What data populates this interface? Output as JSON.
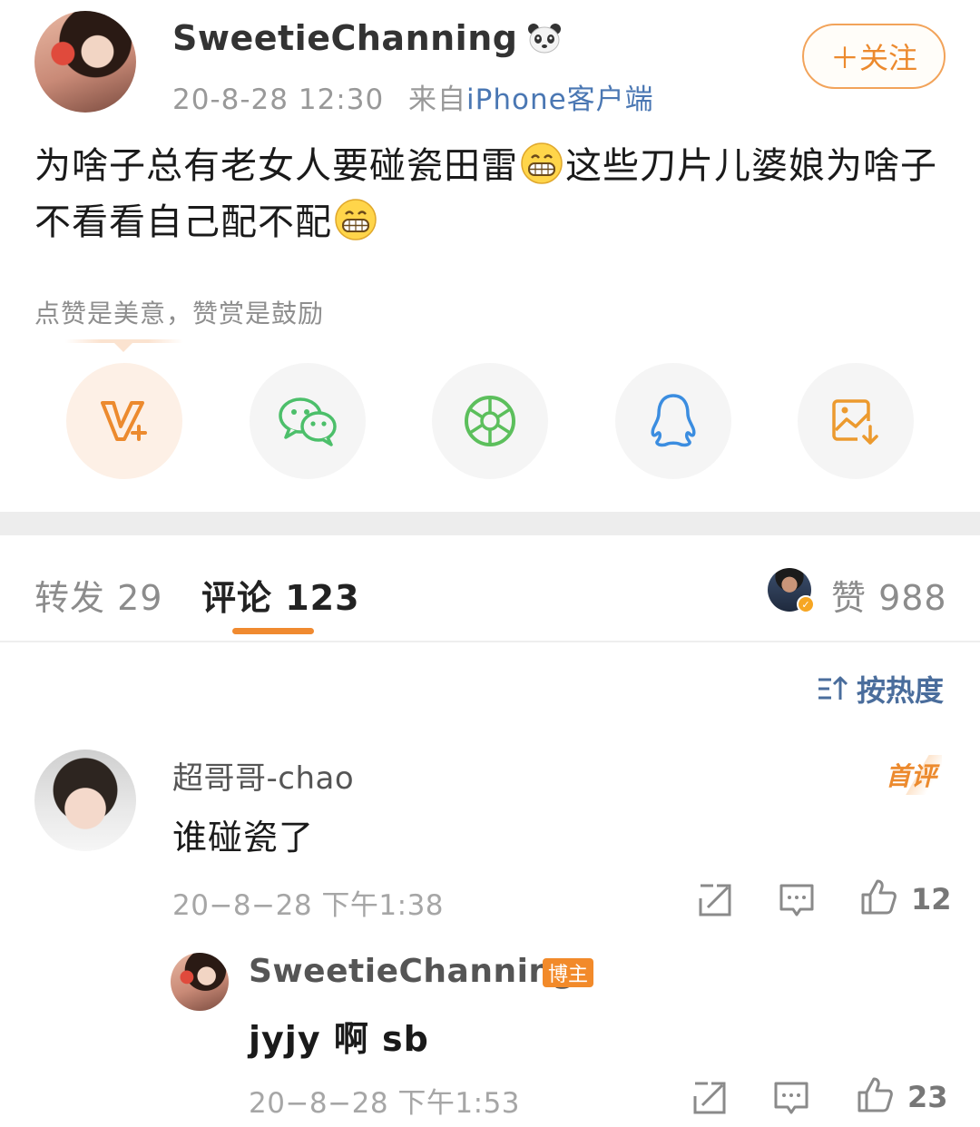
{
  "post": {
    "username": "SweetieChanning",
    "date": "20-8-28 12:30",
    "from_label": "来自",
    "source": "iPhone客户端",
    "follow_label": "＋关注",
    "text_part1": "为啥子总有老女人要碰瓷田雷",
    "text_part2": "这些刀片儿婆娘为啥子不看看自己配不配",
    "emoji": "grinning-face-icon"
  },
  "reward_hint": "点赞是美意，赞赏是鼓励",
  "share": {
    "items": [
      "v-plus-icon",
      "wechat-icon",
      "moments-icon",
      "qq-icon",
      "save-image-icon"
    ]
  },
  "tabs": {
    "repost": "转发 29",
    "comment": "评论 123",
    "likes": "赞 988"
  },
  "sort_label": "按热度",
  "comments": [
    {
      "name": "超哥哥-chao",
      "badge": "首评",
      "text": "谁碰瓷了",
      "time": "20−8−28  下午1:38",
      "likes": "12"
    }
  ],
  "reply": {
    "name": "SweetieChanning",
    "badge": "博主",
    "text": "jyjy 啊 sb",
    "time": "20−8−28  下午1:53",
    "likes": "23"
  },
  "colors": {
    "accent": "#f08a30",
    "link": "#4a77b3",
    "sort": "#4a6d9c"
  }
}
